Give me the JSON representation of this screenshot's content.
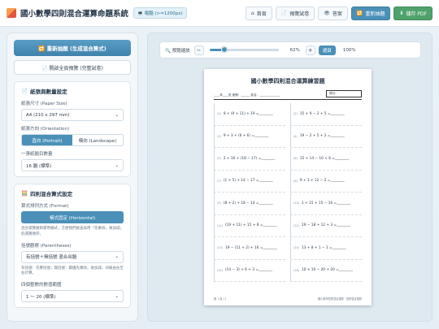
{
  "header": {
    "title": "國小數學四則混合運算命題系統",
    "badge": "💻 電腦 (>=1200px)",
    "buttons": [
      {
        "icon": "⌂",
        "label": "首頁"
      },
      {
        "icon": "📄",
        "label": "預覽試卷"
      },
      {
        "icon": "👁",
        "label": "答案"
      },
      {
        "icon": "🔁",
        "label": "重新抽題"
      },
      {
        "icon": "⬇",
        "label": "儲存 PDF"
      }
    ]
  },
  "sidebar": {
    "primary_button": "🔁 重新抽題 (生成混合算式)",
    "secondary_button": "📄 開啟全頁預覽 (完整試卷)",
    "paper_section": {
      "title": "紙張與數量設定",
      "paper_size_label": "紙張尺寸 (Paper Size)",
      "paper_size_value": "A4 (210 x 297 mm)",
      "orientation_label": "紙張方向 (Orientation)",
      "orientation_options": [
        "直向 (Portrait)",
        "橫向 (Landscape)"
      ],
      "count_label": "一張紙題目數量",
      "count_value": "16 題 (標準)"
    },
    "formula_section": {
      "title": "四則混合算式設定",
      "layout_label": "算式排列方式 (Format)",
      "layout_value": "橫式固定 (Horizontal)",
      "layout_hint": "混合運算題目需用橫式，方便我們檢查與用「先乘除，後加減」的運算順序。",
      "paren_label": "括號觀察 (Parentheses)",
      "paren_value": "有括號＋無括號 混合出題",
      "paren_hint": "有括號：先算括號；無括號：最優先乘除，後加減，同級由左至右計算。",
      "range_label": "四個整數的數值範圍",
      "range_value": "1 ～ 20 (標準)"
    }
  },
  "preview": {
    "zoom_label": "🔍 預覽縮放",
    "zoom_minus": "−",
    "zoom_plus": "+",
    "zoom_percent": 62,
    "zoom_value_text": "62%",
    "fit_button": "適頁",
    "reset_button": "100%"
  },
  "worksheet": {
    "title": "國小數學四則混合運算練習題",
    "info": "____年____班  座號：______  姓名：______________",
    "score": "得分：",
    "problems": [
      {
        "no": "(1)",
        "expr": "9 + (9 + 11) + 19 ="
      },
      {
        "no": "(2)",
        "expr": "15 + 9 − 2 + 5 ="
      },
      {
        "no": "(3)",
        "expr": "9 + 3 + (6 + 6) ="
      },
      {
        "no": "(4)",
        "expr": "19 − 2 + 5 + 2 ="
      },
      {
        "no": "(5)",
        "expr": "2 + 16 + (18 − 17) ="
      },
      {
        "no": "(6)",
        "expr": "15 + 14 − 10 + 6 ="
      },
      {
        "no": "(7)",
        "expr": "(1 + 5) + 14 − 17 ="
      },
      {
        "no": "(8)",
        "expr": "9 + 3 + 12 − 2 ="
      },
      {
        "no": "(9)",
        "expr": "(8 + 2) + 18 − 14 ="
      },
      {
        "no": "(10)",
        "expr": "1 + 15 + 15 − 16 ="
      },
      {
        "no": "(11)",
        "expr": "(19 + 11) + 15 + 8 ="
      },
      {
        "no": "(12)",
        "expr": "19 − 18 + 12 + 3 ="
      },
      {
        "no": "(13)",
        "expr": "19 − (11 + 2) + 16 ="
      },
      {
        "no": "(14)",
        "expr": "13 + 8 + 1 − 1 ="
      },
      {
        "no": "(15)",
        "expr": "(14 − 3) + 6 + 3 ="
      },
      {
        "no": "(16)",
        "expr": "10 + 10 − 20 + 20 ="
      }
    ],
    "footer_left": "第 1 頁 / 1",
    "footer_right": "國小數學四則混合運算 · 四則混合運算"
  }
}
